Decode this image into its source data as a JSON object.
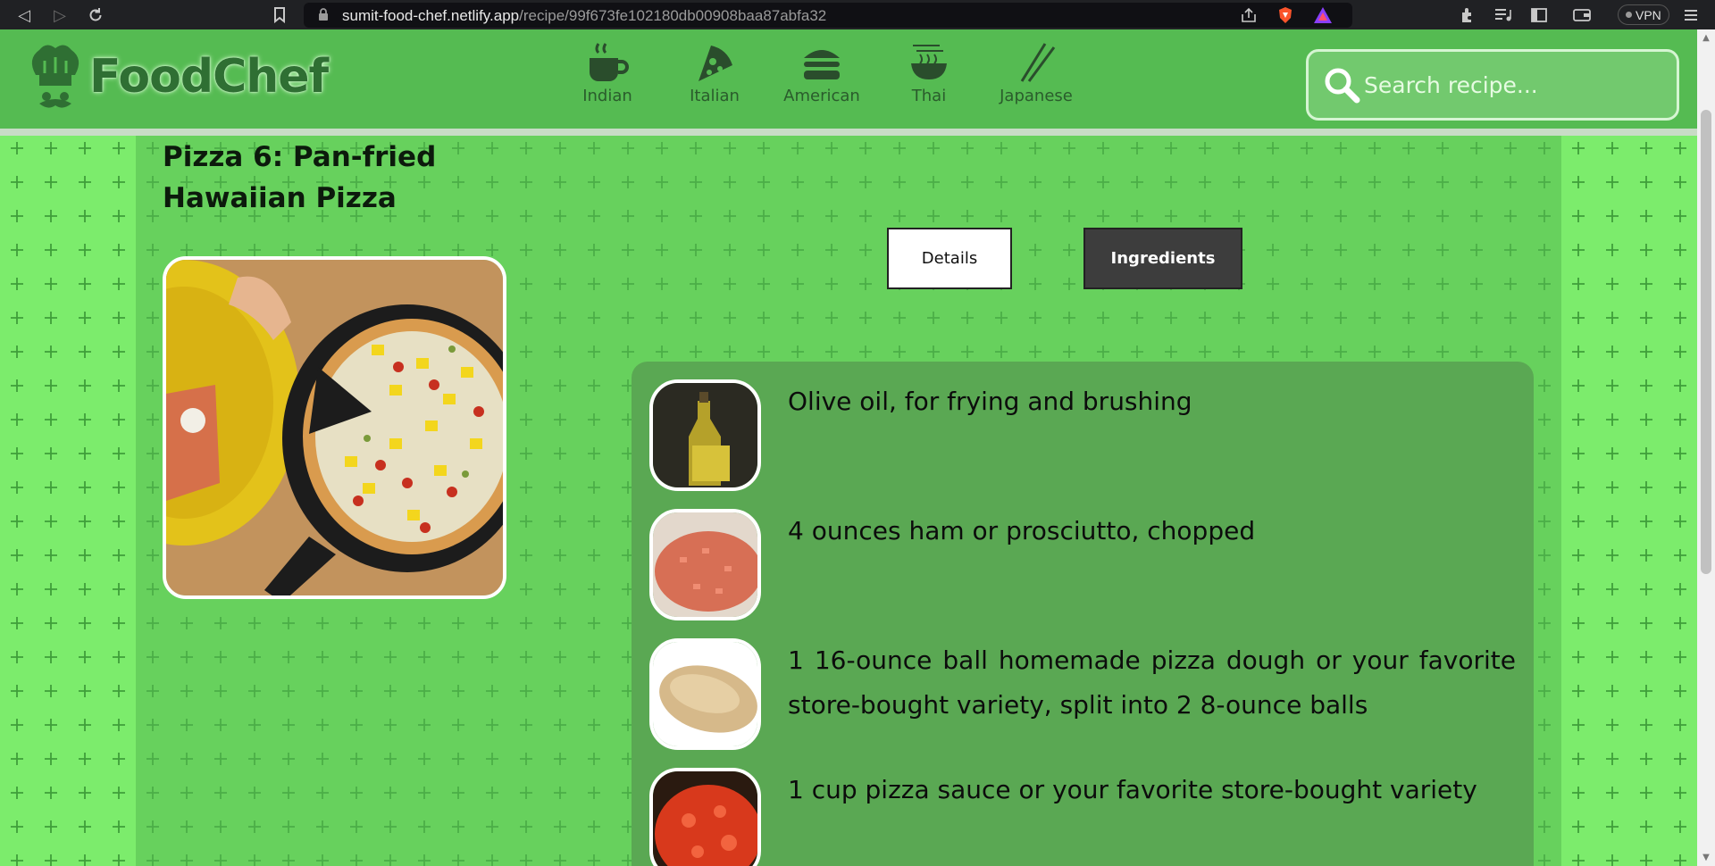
{
  "browser": {
    "url_domain": "sumit-food-chef.netlify.app",
    "url_path": "/recipe/99f673fe102180db00908baa87abfa32",
    "vpn_label": "VPN"
  },
  "site": {
    "logo_text": "FoodChef",
    "cuisines": [
      {
        "label": "Indian",
        "icon": "cup-icon"
      },
      {
        "label": "Italian",
        "icon": "pizza-slice-icon"
      },
      {
        "label": "American",
        "icon": "burger-icon"
      },
      {
        "label": "Thai",
        "icon": "noodle-bowl-icon"
      },
      {
        "label": "Japanese",
        "icon": "chopsticks-icon"
      }
    ],
    "search_placeholder": "Search recipe..."
  },
  "recipe": {
    "title": "Pizza 6: Pan-fried Hawaiian Pizza",
    "tabs": {
      "details": "Details",
      "ingredients": "Ingredients"
    },
    "ingredients": [
      {
        "text": "Olive oil, for frying and brushing"
      },
      {
        "text": "4 ounces ham or prosciutto, chopped"
      },
      {
        "text": "1 16-ounce ball homemade pizza dough or your favorite store-bought variety, split into 2 8-ounce balls"
      },
      {
        "text": "1 cup pizza sauce or your favorite store-bought variety"
      }
    ]
  },
  "colors": {
    "header_green": "#55bb52",
    "background_green": "#7cec6c",
    "panel_green": "#5aa853",
    "active_tab": "#3d3d3d"
  }
}
